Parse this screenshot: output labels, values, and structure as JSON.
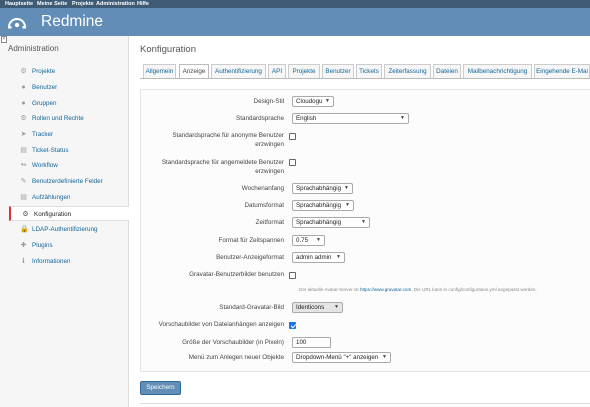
{
  "top_menu": [
    "Hauptseite",
    "Meine Seite",
    "Projekte",
    "Administration",
    "Hilfe"
  ],
  "app_title": "Redmine",
  "sidebar": {
    "title": "Administration",
    "items": [
      {
        "label": "Projekte",
        "icon": "projects-icon"
      },
      {
        "label": "Benutzer",
        "icon": "user-icon"
      },
      {
        "label": "Gruppen",
        "icon": "group-icon"
      },
      {
        "label": "Rollen und Rechte",
        "icon": "roles-icon"
      },
      {
        "label": "Tracker",
        "icon": "tracker-icon"
      },
      {
        "label": "Ticket-Status",
        "icon": "ticket-status-icon"
      },
      {
        "label": "Workflow",
        "icon": "workflow-icon"
      },
      {
        "label": "Benutzerdefinierte Felder",
        "icon": "custom-fields-icon"
      },
      {
        "label": "Aufzählungen",
        "icon": "enumerations-icon"
      },
      {
        "label": "Konfiguration",
        "icon": "gear-icon"
      },
      {
        "label": "LDAP-Authentifizierung",
        "icon": "ldap-icon"
      },
      {
        "label": "Plugins",
        "icon": "plugin-icon"
      },
      {
        "label": "Informationen",
        "icon": "info-icon"
      }
    ],
    "selected": "Konfiguration"
  },
  "page_title": "Konfiguration",
  "tabs": [
    "Allgemein",
    "Anzeige",
    "Authentifizierung",
    "API",
    "Projekte",
    "Benutzer",
    "Tickets",
    "Zeiterfassung",
    "Dateien",
    "Mailbenachrichtigung",
    "Eingehende E-Mai"
  ],
  "selected_tab": "Anzeige",
  "form": {
    "design_label": "Design-Stil",
    "design_value": "Cloudogu",
    "lang_label": "Standardsprache",
    "lang_value": "English",
    "anon_lang_label": "Standardsprache für anonyme Benutzer erzwingen",
    "anon_lang_checked": false,
    "loggedin_lang_label": "Standardsprache für angemeldete Benutzer erzwingen",
    "loggedin_lang_checked": false,
    "week_start_label": "Wochenanfang",
    "week_start_value": "Sprachabhängig",
    "date_format_label": "Datumsformat",
    "date_format_value": "Sprachabhängig",
    "time_format_label": "Zeitformat",
    "time_format_value": "Sprachabhängig",
    "timespan_label": "Format für Zeitspannen",
    "timespan_value": "0.75",
    "user_format_label": "Benutzer-Anzeigeformat",
    "user_format_value": "admin admin",
    "gravatar_label": "Gravatar-Benutzerbilder benutzen",
    "gravatar_checked": false,
    "gravatar_info_prefix": "Der aktuelle Avatar-Server ist",
    "gravatar_info_link": "https://www.gravatar.com",
    "gravatar_info_suffix": ". Die URL kann in config/configuration.yml angepasst werden.",
    "default_gravatar_label": "Standard-Gravatar-Bild",
    "default_gravatar_value": "Identicons",
    "thumbnails_label": "Vorschaubilder von Dateianhängen anzeigen",
    "thumbnails_checked": true,
    "thumb_size_label": "Größe der Vorschaubilder (in Pixeln)",
    "thumb_size_value": "100",
    "new_object_menu_label": "Menü zum Anlegen neuer Objekte",
    "new_object_menu_value": "Dropdown-Menü \"+\" anzeigen"
  },
  "save_label": "Speichern",
  "colors": {
    "header": "#628db6",
    "top_menu": "#3e5b76",
    "link": "#116699",
    "selected_marker": "#dd3333"
  }
}
